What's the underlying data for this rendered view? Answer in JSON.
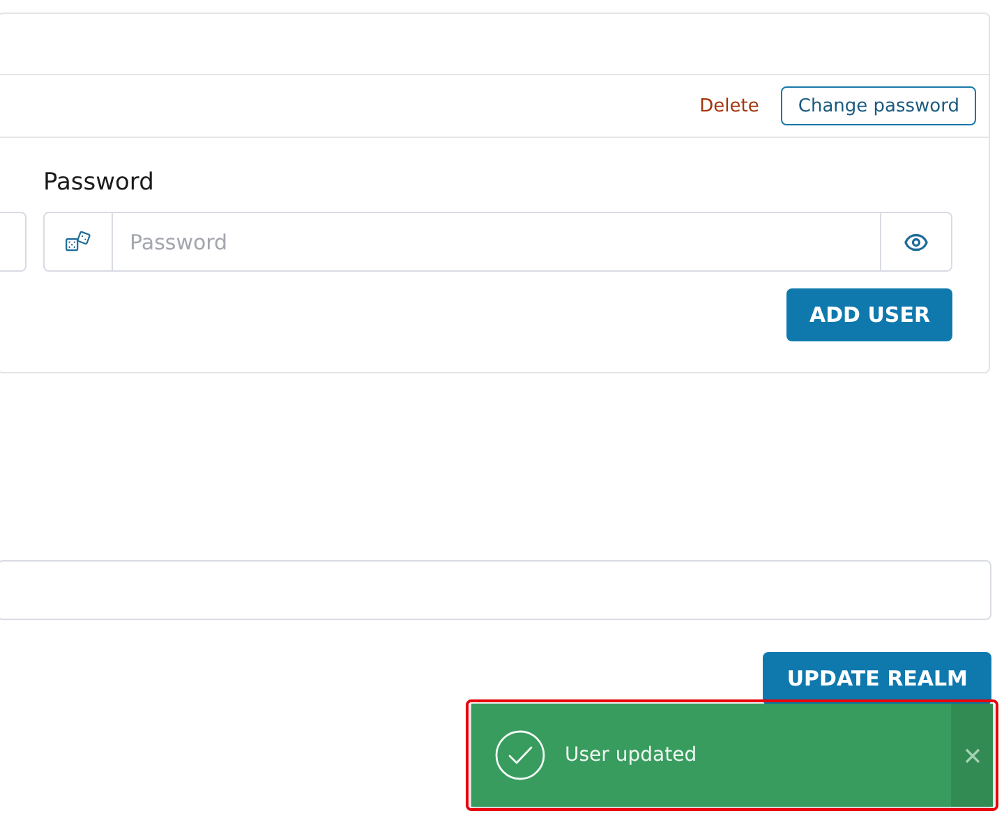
{
  "user_card": {
    "actions": {
      "delete_link": "Delete",
      "change_password_button": "Change password"
    },
    "password_field": {
      "label": "Password",
      "placeholder": "Password"
    },
    "add_user_button": "ADD USER"
  },
  "update_realm_button": "UPDATE REALM",
  "toast": {
    "kind": "success",
    "message": "User updated"
  }
}
